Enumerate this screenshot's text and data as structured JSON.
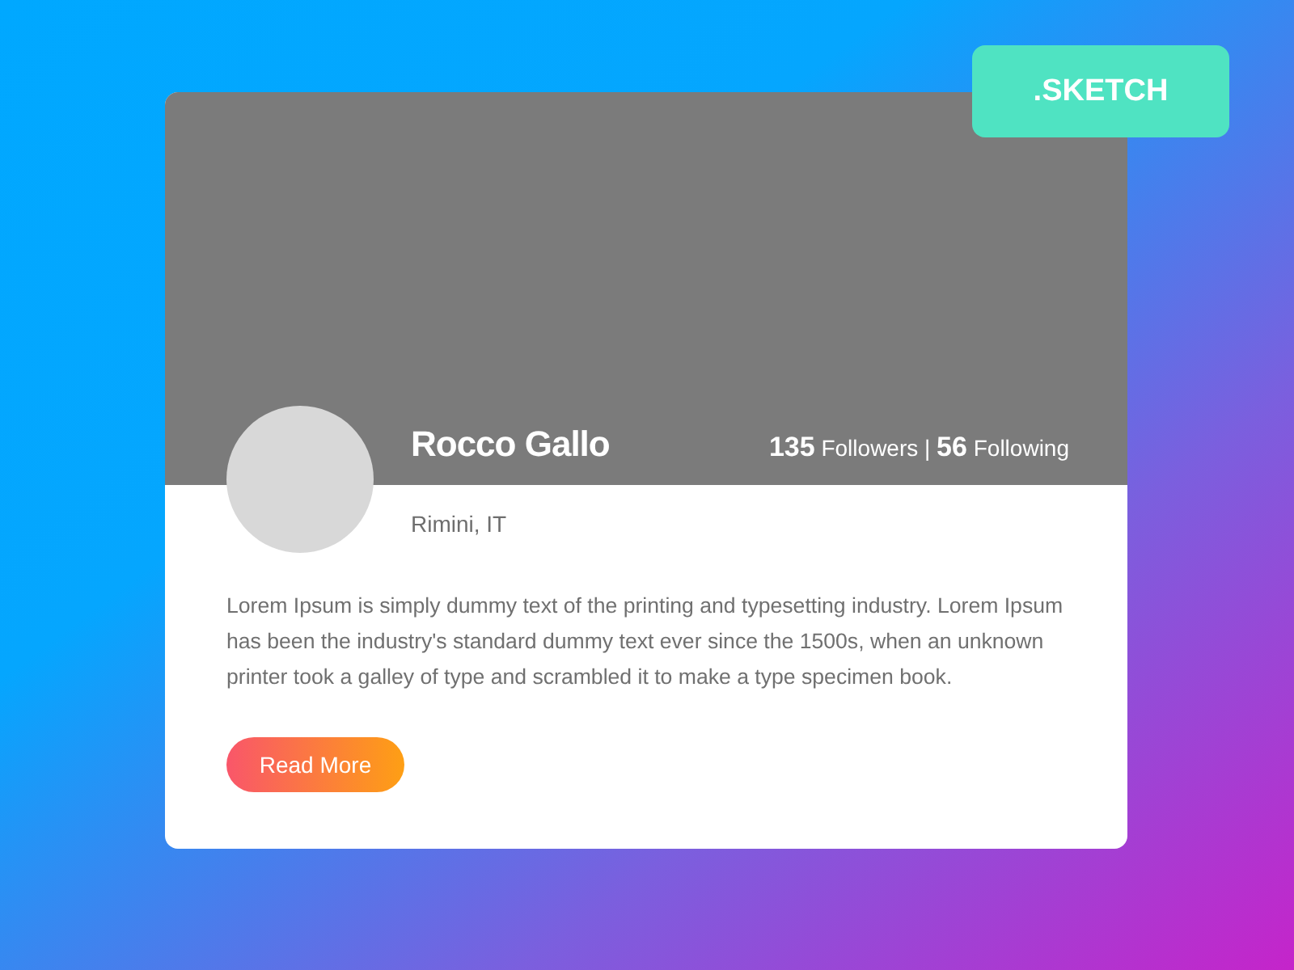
{
  "badge": {
    "label": ".SKETCH"
  },
  "profile": {
    "name": "Rocco Gallo",
    "stats": "**135** Followers | **56** Following",
    "location": "Rimini, IT",
    "bio": "Lorem Ipsum is simply dummy text of the printing and typesetting industry. Lorem Ipsum has been the industry's standard dummy text ever since the 1500s, when an unknown printer took a galley of type and scrambled it to make a type specimen book.",
    "button": "Read More"
  }
}
